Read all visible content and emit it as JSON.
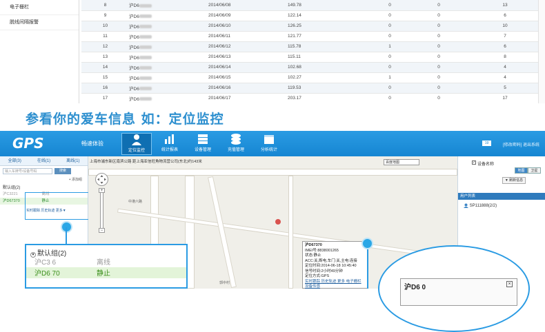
{
  "left_menu": {
    "items": [
      "电子栅栏",
      "脱线间隔报警"
    ]
  },
  "report_rows": [
    {
      "idx": "8",
      "plate": "沪D6",
      "date": "2014/06/08",
      "km": "149.78",
      "a": "0",
      "b": "0",
      "c": "13"
    },
    {
      "idx": "9",
      "plate": "沪D6",
      "date": "2014/06/09",
      "km": "122.14",
      "a": "0",
      "b": "0",
      "c": "6"
    },
    {
      "idx": "10",
      "plate": "沪D6",
      "date": "2014/06/10",
      "km": "126.25",
      "a": "0",
      "b": "0",
      "c": "10"
    },
    {
      "idx": "11",
      "plate": "沪D6",
      "date": "2014/06/11",
      "km": "121.77",
      "a": "0",
      "b": "0",
      "c": "7"
    },
    {
      "idx": "12",
      "plate": "沪D6",
      "date": "2014/06/12",
      "km": "115.78",
      "a": "1",
      "b": "0",
      "c": "6"
    },
    {
      "idx": "13",
      "plate": "沪D6",
      "date": "2014/06/13",
      "km": "115.11",
      "a": "0",
      "b": "0",
      "c": "8"
    },
    {
      "idx": "14",
      "plate": "沪D6",
      "date": "2014/06/14",
      "km": "102.68",
      "a": "0",
      "b": "0",
      "c": "4"
    },
    {
      "idx": "15",
      "plate": "沪D6",
      "date": "2014/06/15",
      "km": "102.27",
      "a": "1",
      "b": "0",
      "c": "4"
    },
    {
      "idx": "16",
      "plate": "沪D6",
      "date": "2014/06/16",
      "km": "119.53",
      "a": "0",
      "b": "0",
      "c": "5"
    },
    {
      "idx": "17",
      "plate": "沪D6",
      "date": "2014/06/17",
      "km": "203.17",
      "a": "0",
      "b": "0",
      "c": "17"
    }
  ],
  "caption": "参看你的爱车信息 如：定位监控",
  "header": {
    "logo": "GPS",
    "experience": "畅速体验",
    "nav": [
      "定位监控",
      "统计报表",
      "设备管理",
      "充值管理",
      "分析统计"
    ],
    "badge": "19",
    "links": "[修改密码] 退出系统"
  },
  "left_panel": {
    "tabs": [
      "全部(3)",
      "在线(1)",
      "离线(1)"
    ],
    "search_placeholder": "输入车牌号/设备号码",
    "search_button": "搜索",
    "add_group": "+ 添加组",
    "group_title": "默认组(2)",
    "vehicles": [
      {
        "plate": "沪C3221",
        "status": "离线"
      },
      {
        "plate": "沪D67370",
        "status": "静止"
      }
    ],
    "actions": "实时跟踪 历史轨迹 更多▼"
  },
  "map": {
    "address": "上海市浦东新区南滨公路 距上海亚信旺角物流营公司(东北)约143米",
    "map_select": "百度地图",
    "labels": [
      "中港六路",
      "郭中村",
      "中港六路"
    ],
    "info": {
      "title": "沪D67370",
      "imei": "IMEI号:8838001265",
      "status": "状态:静止",
      "acc": "ACC:关,断电,车门:关,主电:连接",
      "gps_time": "定位时间:2014-06-18 10:45:40",
      "sig_time": "信号时间:2小时49分钟",
      "mode": "定位方式:GPS",
      "links": "实时跟踪 历史轨迹 更多 电子栅栏 设备传感"
    }
  },
  "right_panel": {
    "device_name": "设备名称",
    "map_btn": "地图",
    "sat_btn": "卫星",
    "refresh": "▼ 刷新信息",
    "user_list": "用户列表",
    "user_item": "SP111888(2/2)"
  },
  "zoom_left": {
    "group_title": "默认组(2)",
    "rows": [
      {
        "plate": "沪C3    6",
        "status": "离线"
      },
      {
        "plate": "沪D6    70",
        "status": "静止"
      }
    ]
  },
  "zoom_right": {
    "plate": "沪D6    0",
    "close": "×"
  },
  "colors": {
    "brand_blue": "#1686d2",
    "caption_blue": "#2d8fcf",
    "status_green": "#3a8f1a"
  }
}
